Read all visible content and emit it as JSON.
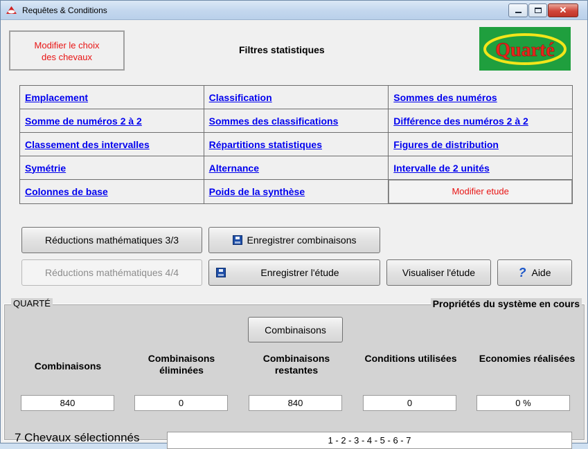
{
  "window": {
    "title": "Requêtes & Conditions",
    "close_glyph": "✕"
  },
  "header": {
    "modifier_chevaux": [
      "Modifier le choix",
      "des chevaux"
    ],
    "filtres_title": "Filtres statistiques",
    "logo_text": "Quarté",
    "logo_colors": {
      "background": "#1f9f3e",
      "text": "#e8261c",
      "ellipse": "#f2e51a"
    }
  },
  "filters": [
    [
      "Emplacement",
      "Classification",
      "Sommes des numéros"
    ],
    [
      "Somme de numéros 2 à 2",
      "Sommes des classifications",
      "Différence des numéros 2 à 2"
    ],
    [
      "Classement des intervalles",
      "Répartitions statistiques",
      "Figures de distribution"
    ],
    [
      "Symétrie",
      "Alternance",
      "Intervalle de 2 unités"
    ],
    [
      "Colonnes de base",
      "Poids de la synthèse",
      "Modifier etude"
    ]
  ],
  "buttons": {
    "reductions_3": "Réductions mathématiques 3/3",
    "enregistrer_combinaisons": "Enregistrer combinaisons",
    "reductions_4": "Réductions mathématiques 4/4",
    "enregistrer_etude": "Enregistrer l'étude",
    "visualiser_etude": "Visualiser l'étude",
    "aide": "Aide"
  },
  "system": {
    "group_label": "QUARTÉ",
    "properties_label": "Propriétés du système en cours",
    "combinaisons_button": "Combinaisons",
    "stats": [
      {
        "label": "Combinaisons",
        "value": "840"
      },
      {
        "label": "Combinaisons éliminées",
        "value": "0"
      },
      {
        "label": "Combinaisons restantes",
        "value": "840"
      },
      {
        "label": "Conditions utilisées",
        "value": "0"
      },
      {
        "label": "Economies réalisées",
        "value": "0 %"
      }
    ],
    "chevaux_label": "7 Chevaux sélectionnés",
    "chevaux_value": "1 - 2 - 3 - 4 - 5 - 6 - 7"
  },
  "colors": {
    "accent_red": "#e81414",
    "link_blue": "#0000ee",
    "group_bg": "#d3d3d3"
  }
}
